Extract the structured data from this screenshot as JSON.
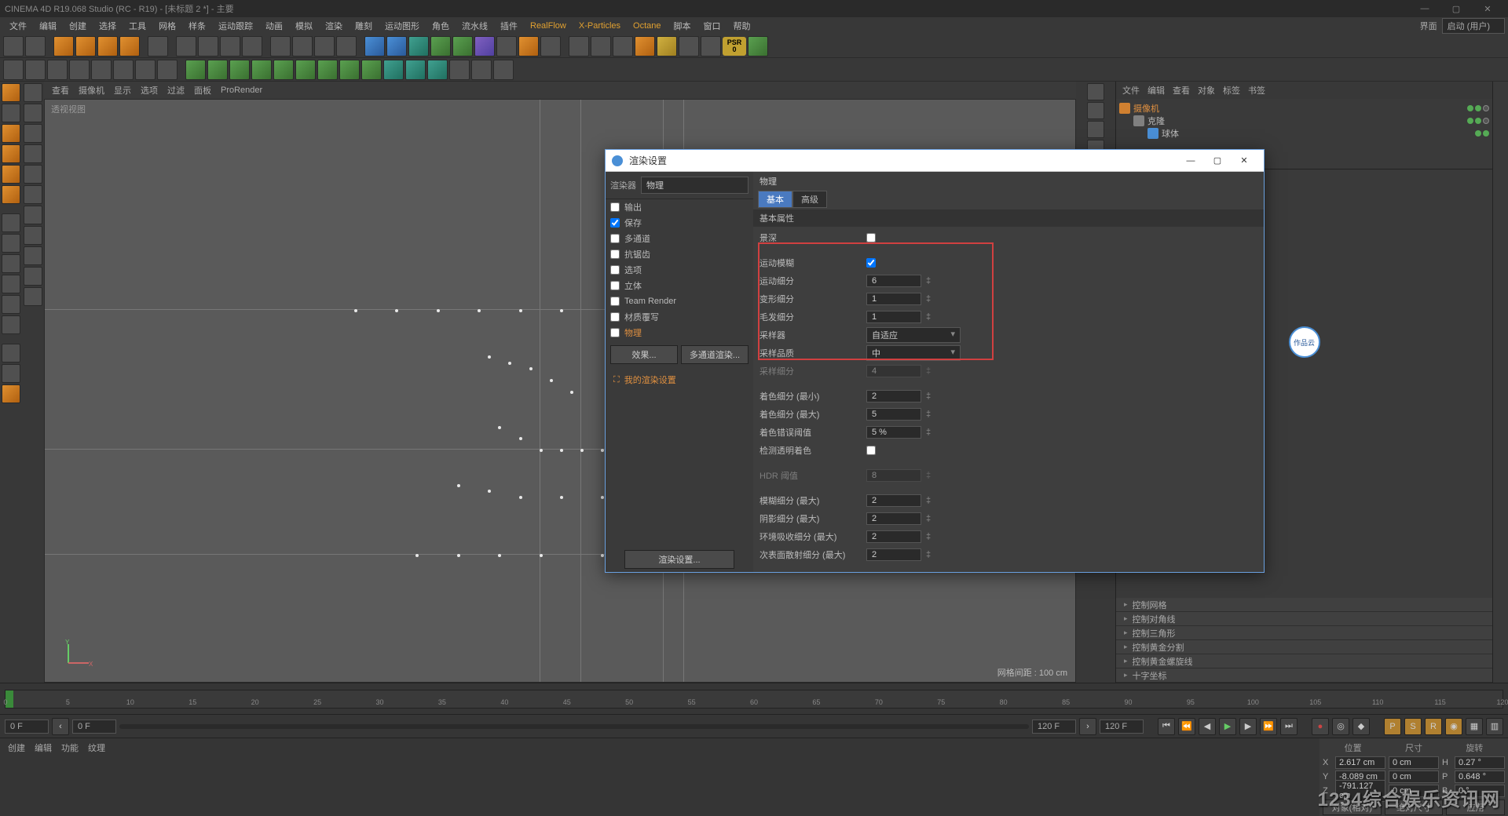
{
  "app": {
    "title": "CINEMA 4D R19.068 Studio (RC - R19) - [未标题 2 *] - 主要"
  },
  "menu": {
    "items": [
      "文件",
      "编辑",
      "创建",
      "选择",
      "工具",
      "网格",
      "样条",
      "运动跟踪",
      "动画",
      "模拟",
      "渲染",
      "雕刻",
      "运动图形",
      "角色",
      "流水线",
      "插件",
      "RealFlow",
      "X-Particles",
      "Octane",
      "脚本",
      "窗口",
      "帮助"
    ],
    "layout_label": "界面",
    "layout_value": "启动 (用户)"
  },
  "viewport": {
    "menu_items": [
      "查看",
      "摄像机",
      "显示",
      "选项",
      "过滤",
      "面板",
      "ProRender"
    ],
    "label": "透视视图",
    "grid_status": "网格间距 : 100 cm"
  },
  "object_manager": {
    "menu": [
      "文件",
      "编辑",
      "查看",
      "对象",
      "标签",
      "书签"
    ],
    "rows": [
      {
        "name": "摄像机",
        "selected": true,
        "type": "cam"
      },
      {
        "name": "克隆",
        "selected": false,
        "type": "null"
      },
      {
        "name": "球体",
        "selected": false,
        "type": "sphere"
      }
    ]
  },
  "accordion": {
    "items": [
      "控制网格",
      "控制对角线",
      "控制三角形",
      "控制黄金分割",
      "控制黄金螺旋线",
      "十字坐标"
    ]
  },
  "timeline": {
    "start": "0 F",
    "end": "120 F",
    "current_a": "0 F",
    "current_b": "120 F",
    "ticks": [
      "0",
      "5",
      "10",
      "15",
      "20",
      "25",
      "30",
      "35",
      "40",
      "45",
      "50",
      "55",
      "60",
      "65",
      "70",
      "75",
      "80",
      "85",
      "90",
      "95",
      "100",
      "105",
      "110",
      "115",
      "120"
    ]
  },
  "bottom_tabs": {
    "items": [
      "创建",
      "编辑",
      "功能",
      "纹理"
    ]
  },
  "coords": {
    "headers": [
      "位置",
      "尺寸",
      "旋转"
    ],
    "rows": [
      {
        "axis": "X",
        "pos": "2.617 cm",
        "size": "0 cm",
        "rot": "H",
        "rotval": "0.27 °"
      },
      {
        "axis": "Y",
        "pos": "-8.089 cm",
        "size": "0 cm",
        "rot": "P",
        "rotval": "0.648 °"
      },
      {
        "axis": "Z",
        "pos": "-791.127 cm",
        "size": "0 cm",
        "rot": "B",
        "rotval": "0 °"
      }
    ],
    "mode_a": "对象(相对)",
    "mode_b": "绝对尺寸",
    "apply": "应用"
  },
  "dialog": {
    "title": "渲染设置",
    "renderer_label": "渲染器",
    "renderer_value": "物理",
    "categories": [
      {
        "label": "输出",
        "chk": false
      },
      {
        "label": "保存",
        "chk": true
      },
      {
        "label": "多通道",
        "chk": false
      },
      {
        "label": "抗锯齿",
        "chk": false
      },
      {
        "label": "选项",
        "chk": false
      },
      {
        "label": "立体",
        "chk": false
      },
      {
        "label": "Team Render",
        "chk": false
      },
      {
        "label": "材质覆写",
        "chk": false
      },
      {
        "label": "物理",
        "chk": false,
        "active": true
      }
    ],
    "btn_effects": "效果...",
    "btn_multipass": "多通道渲染...",
    "my_settings": "我的渲染设置",
    "footer_btn": "渲染设置...",
    "section": "物理",
    "tabs": [
      "基本",
      "高级"
    ],
    "tab_active": 0,
    "sub_header": "基本属性",
    "props": [
      {
        "label": "景深",
        "type": "chk",
        "value": false
      },
      {
        "label": "运动模糊",
        "type": "chk",
        "value": true,
        "boxed": true
      },
      {
        "label": "运动细分",
        "type": "num",
        "value": "6",
        "boxed": true
      },
      {
        "label": "变形细分",
        "type": "num",
        "value": "1",
        "boxed": true
      },
      {
        "label": "毛发细分",
        "type": "num",
        "value": "1",
        "boxed": true
      },
      {
        "label": "采样器",
        "type": "sel",
        "value": "自适应",
        "boxed": true
      },
      {
        "label": "采样品质",
        "type": "sel",
        "value": "中",
        "boxed": true
      },
      {
        "label": "采样细分",
        "type": "num",
        "value": "4",
        "boxed": true,
        "disabled": true
      },
      {
        "label": "着色细分 (最小)",
        "type": "num",
        "value": "2"
      },
      {
        "label": "着色细分 (最大)",
        "type": "num",
        "value": "5"
      },
      {
        "label": "着色错误阈值",
        "type": "num",
        "value": "5 %"
      },
      {
        "label": "检测透明着色",
        "type": "chk",
        "value": false
      },
      {
        "label": "HDR 阈值",
        "type": "num",
        "value": "8",
        "disabled": true
      },
      {
        "label": "模糊细分 (最大)",
        "type": "num",
        "value": "2"
      },
      {
        "label": "阴影细分 (最大)",
        "type": "num",
        "value": "2"
      },
      {
        "label": "环境吸收细分 (最大)",
        "type": "num",
        "value": "2"
      },
      {
        "label": "次表面散射细分 (最大)",
        "type": "num",
        "value": "2"
      }
    ]
  },
  "psr": "PSR",
  "watermark_circle": "作品云",
  "bottom_watermark": "1234综合娱乐资讯网"
}
